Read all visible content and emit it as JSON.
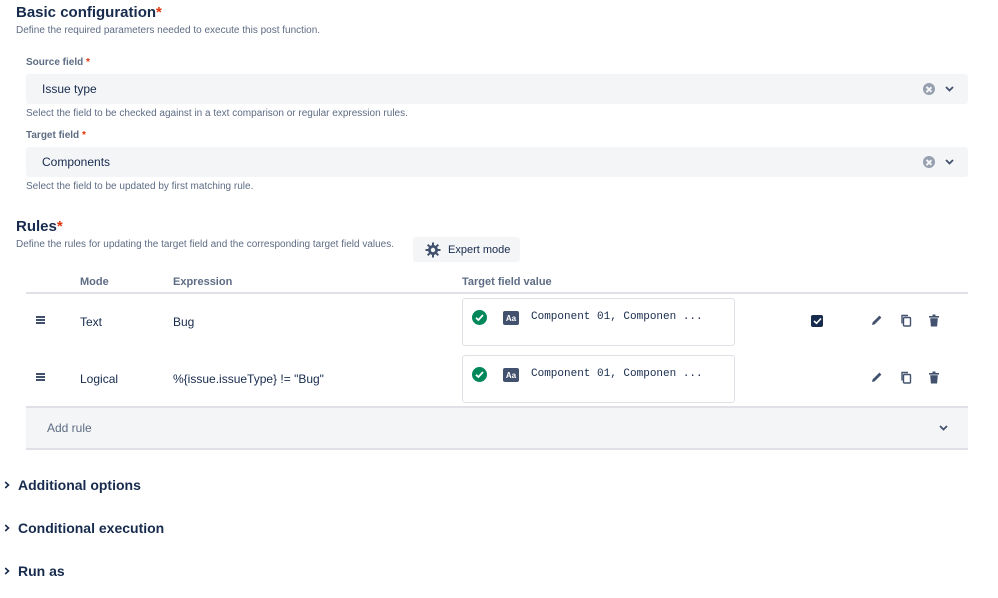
{
  "basic": {
    "title": "Basic configuration",
    "required": "*",
    "description": "Define the required parameters needed to execute this post function."
  },
  "source_field": {
    "label": "Source field",
    "required": "*",
    "value": "Issue type",
    "helper": "Select the field to be checked against in a text comparison or regular expression rules."
  },
  "target_field": {
    "label": "Target field",
    "required": "*",
    "value": "Components",
    "helper": "Select the field to be updated by first matching rule."
  },
  "rules": {
    "title": "Rules",
    "required": "*",
    "description": "Define the rules for updating the target field and the corresponding target field values.",
    "expert_mode_label": "Expert mode",
    "columns": {
      "mode": "Mode",
      "expression": "Expression",
      "target_value": "Target field value"
    },
    "rows": [
      {
        "mode": "Text",
        "expression": "Bug",
        "value_type_badge": "Aa",
        "target_value": "Component 01, Componen ...",
        "checked": true
      },
      {
        "mode": "Logical",
        "expression": "%{issue.issueType} != \"Bug\"",
        "value_type_badge": "Aa",
        "target_value": "Component 01, Componen ...",
        "checked": false
      }
    ],
    "add_rule_label": "Add rule"
  },
  "collapsibles": {
    "additional_options": "Additional options",
    "conditional_execution": "Conditional execution",
    "run_as": "Run as"
  },
  "colors": {
    "text": "#172b4d",
    "subtle_text": "#5e6c84",
    "required": "#de350b",
    "field_bg": "#f4f5f7",
    "success": "#00875a",
    "border": "#dfe1e6"
  }
}
